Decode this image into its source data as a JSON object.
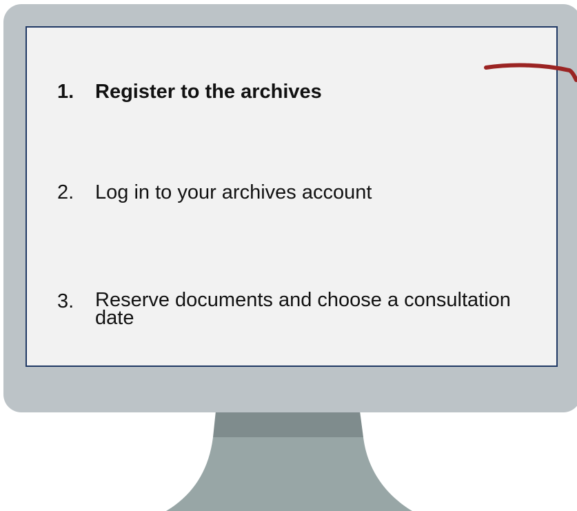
{
  "steps": [
    {
      "number": "1.",
      "label": "Register to the archives",
      "active": true
    },
    {
      "number": "2.",
      "label": "Log in to your archives account",
      "active": false
    },
    {
      "number": "3.",
      "label": "Reserve documents and choose a consultation date",
      "active": false
    }
  ],
  "colors": {
    "bezel": "#bcc3c7",
    "screen": "#f2f2f2",
    "screen_border": "#1f3864",
    "neck_dark": "#7f8c8d",
    "neck_light": "#98a6a6",
    "pointer": "#9b2423"
  }
}
